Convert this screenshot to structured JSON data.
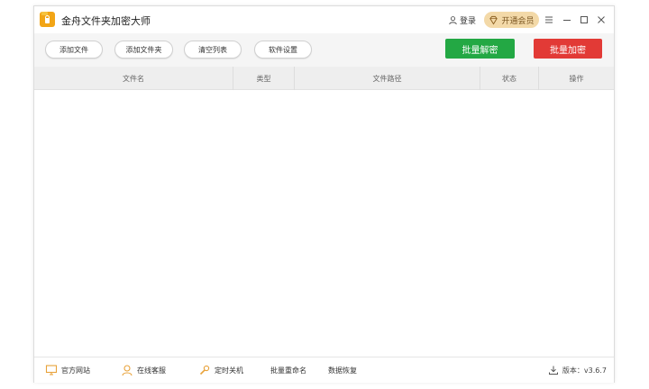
{
  "app": {
    "title": "金舟文件夹加密大师"
  },
  "titlebar": {
    "login_label": "登录",
    "vip_label": "开通会员"
  },
  "toolbar": {
    "add_file": "添加文件",
    "add_folder": "添加文件夹",
    "clear_list": "清空列表",
    "settings": "软件设置",
    "batch_decrypt": "批量解密",
    "batch_encrypt": "批量加密"
  },
  "table": {
    "columns": [
      "文件名",
      "类型",
      "文件路径",
      "状态",
      "操作"
    ],
    "rows": []
  },
  "footer": {
    "website": "官方网站",
    "support": "在线客服",
    "shutdown": "定时关机",
    "rename": "批量重命名",
    "recovery": "数据恢复",
    "version": "版本：v3.6.7"
  },
  "colors": {
    "decrypt_button": "#23a844",
    "encrypt_button": "#e23a36",
    "app_icon": "#f2a516",
    "vip_badge": "#f3d9a8",
    "accent_orange": "#e8a23a"
  },
  "icons": [
    "folder-lock-icon",
    "user-icon",
    "diamond-icon",
    "menu-icon",
    "minimize-icon",
    "maximize-icon",
    "close-icon",
    "monitor-icon",
    "headset-icon",
    "wrench-icon",
    "download-icon"
  ]
}
